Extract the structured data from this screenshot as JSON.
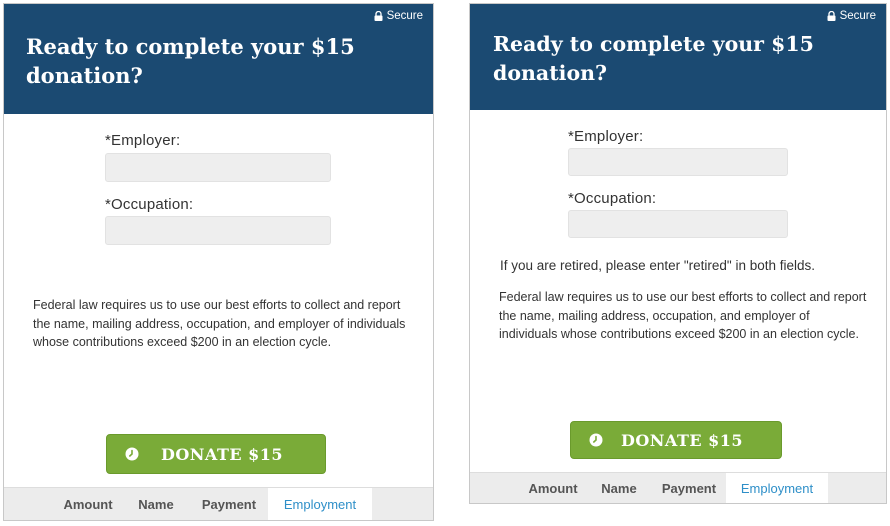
{
  "panels": [
    {
      "secure_label": "Secure",
      "title": "Ready to complete your $15 donation?",
      "employer_label": "*Employer:",
      "employer_value": "",
      "occupation_label": "*Occupation:",
      "occupation_value": "",
      "legal_text": "Federal law requires us to use our best efforts to collect and report the name, mailing address, occupation, and employer of individuals whose contributions exceed $200 in an election cycle.",
      "donate_label": "DONATE $15",
      "steps": [
        "Amount",
        "Name",
        "Payment",
        "Employment"
      ],
      "active_step": "Employment"
    },
    {
      "secure_label": "Secure",
      "title": "Ready to complete your $15 donation?",
      "employer_label": "*Employer:",
      "employer_value": "",
      "occupation_label": "*Occupation:",
      "occupation_value": "",
      "retired_note": "If you are retired, please enter \"retired\" in both fields.",
      "legal_text": "Federal law requires us to use our best efforts to collect and report the name, mailing address, occupation, and employer of individuals whose contributions exceed $200 in an election cycle.",
      "donate_label": "DONATE $15",
      "steps": [
        "Amount",
        "Name",
        "Payment",
        "Employment"
      ],
      "active_step": "Employment"
    }
  ],
  "colors": {
    "header_bg": "#1b4a72",
    "button_bg": "#7aab38",
    "active_step": "#2e8fc8",
    "step_bar_bg": "#ececec"
  },
  "icons": {
    "secure": "lock-icon",
    "donate": "clock-icon"
  }
}
